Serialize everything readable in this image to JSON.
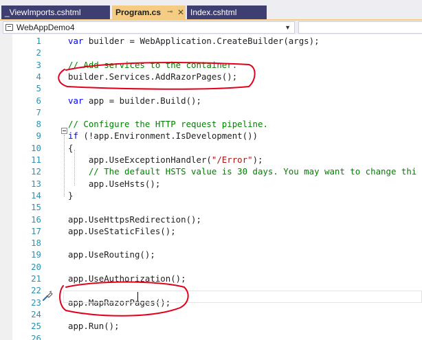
{
  "tabs": [
    {
      "label": "_ViewImports.cshtml",
      "active": false
    },
    {
      "label": "Program.cs",
      "active": true,
      "pin": "⊸",
      "close": "✕"
    },
    {
      "label": "Index.cshtml",
      "active": false
    }
  ],
  "navbar": {
    "project": "WebAppDemo4",
    "dropdown_icon": "chevron-down-icon"
  },
  "colors": {
    "accent": "#f5cc84",
    "tab_inactive": "#3e3e71",
    "keyword": "#0000ff",
    "comment": "#008000",
    "string": "#a31515",
    "line_number": "#2b91af",
    "annotation": "#e3001b"
  },
  "editor": {
    "current_line": 23,
    "lines": [
      {
        "n": "1",
        "parts": [
          {
            "t": "var",
            "c": "kw"
          },
          {
            "t": " builder = WebApplication.CreateBuilder(args);"
          }
        ]
      },
      {
        "n": "2",
        "parts": []
      },
      {
        "n": "3",
        "parts": [
          {
            "t": "// Add services to the container.",
            "c": "cm"
          }
        ]
      },
      {
        "n": "4",
        "parts": [
          {
            "t": "builder.Services.AddRazorPages();"
          }
        ]
      },
      {
        "n": "5",
        "parts": []
      },
      {
        "n": "6",
        "parts": [
          {
            "t": "var",
            "c": "kw"
          },
          {
            "t": " app = builder.Build();"
          }
        ]
      },
      {
        "n": "7",
        "parts": []
      },
      {
        "n": "8",
        "parts": [
          {
            "t": "// Configure the HTTP request pipeline.",
            "c": "cm"
          }
        ]
      },
      {
        "n": "9",
        "parts": [
          {
            "t": "if",
            "c": "kw"
          },
          {
            "t": " (!app.Environment.IsDevelopment())"
          }
        ]
      },
      {
        "n": "10",
        "parts": [
          {
            "t": "{"
          }
        ]
      },
      {
        "n": "11",
        "parts": [
          {
            "t": "    app.UseExceptionHandler("
          },
          {
            "t": "\"/Error\"",
            "c": "str"
          },
          {
            "t": ");"
          }
        ]
      },
      {
        "n": "12",
        "parts": [
          {
            "t": "    // The default HSTS value is 30 days. You may want to change thi",
            "c": "cm"
          }
        ]
      },
      {
        "n": "13",
        "parts": [
          {
            "t": "    app.UseHsts();"
          }
        ]
      },
      {
        "n": "14",
        "parts": [
          {
            "t": "}"
          }
        ]
      },
      {
        "n": "15",
        "parts": []
      },
      {
        "n": "16",
        "parts": [
          {
            "t": "app.UseHttpsRedirection();"
          }
        ]
      },
      {
        "n": "17",
        "parts": [
          {
            "t": "app.UseStaticFiles();"
          }
        ]
      },
      {
        "n": "18",
        "parts": []
      },
      {
        "n": "19",
        "parts": [
          {
            "t": "app.UseRouting();"
          }
        ]
      },
      {
        "n": "20",
        "parts": []
      },
      {
        "n": "21",
        "parts": [
          {
            "t": "app.UseAuthorization();"
          }
        ]
      },
      {
        "n": "22",
        "parts": []
      },
      {
        "n": "23",
        "parts": [
          {
            "t": "app.MapRazorPages();"
          }
        ]
      },
      {
        "n": "24",
        "parts": []
      },
      {
        "n": "25",
        "parts": [
          {
            "t": "app.Run();"
          }
        ]
      },
      {
        "n": "26",
        "parts": []
      }
    ]
  },
  "icons": {
    "outline_toggle": "collapse-minus-icon",
    "quick_action": "paintbrush-icon"
  }
}
